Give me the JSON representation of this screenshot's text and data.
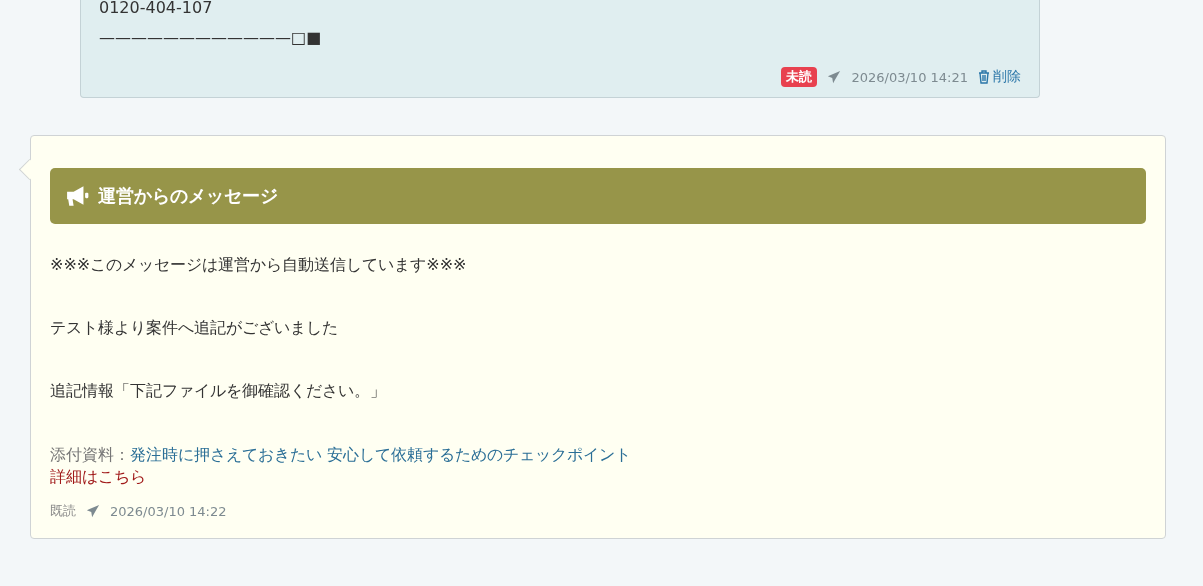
{
  "messages": [
    {
      "lines": [
        "0120-404-107",
        "————————————□■"
      ],
      "read": false,
      "status_label": "未読",
      "timestamp": "2026/03/10 14:21",
      "delete_label": "削除"
    },
    {
      "header": "運営からのメッセージ",
      "paragraphs": [
        "※※※このメッセージは運営から自動送信しています※※※",
        "テスト様より案件へ追記がございました",
        "追記情報「下記ファイルを御確認ください。」"
      ],
      "attachment_label": "添付資料：",
      "attachment_link": "発注時に押さえておきたい 安心して依頼するためのチェックポイント",
      "details_link": "詳細はこちら",
      "read": true,
      "status_label": "既読",
      "timestamp": "2026/03/10 14:22"
    }
  ]
}
